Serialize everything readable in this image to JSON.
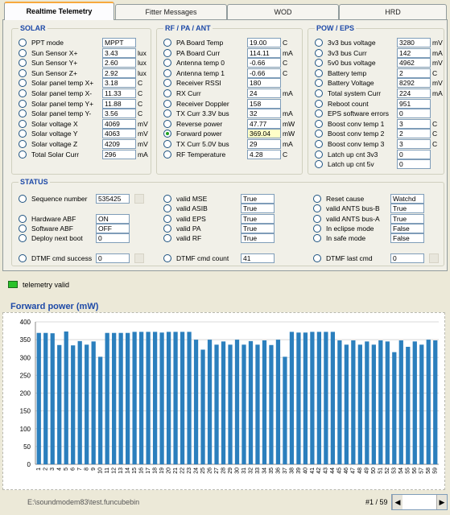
{
  "tabs": [
    "Realtime Telemetry",
    "Fitter Messages",
    "WOD",
    "HRD"
  ],
  "solar": {
    "title": "SOLAR",
    "rows": [
      {
        "label": "PPT mode",
        "value": "MPPT",
        "unit": ""
      },
      {
        "label": "Sun Sensor X+",
        "value": "3.43",
        "unit": "lux"
      },
      {
        "label": "Sun Sensor Y+",
        "value": "2.60",
        "unit": "lux"
      },
      {
        "label": "Sun Sensor Z+",
        "value": "2.92",
        "unit": "lux"
      },
      {
        "label": "Solar panel temp X+",
        "value": "3.18",
        "unit": "C"
      },
      {
        "label": "Solar panel temp X-",
        "value": "11.33",
        "unit": "C"
      },
      {
        "label": "Solar panel temp Y+",
        "value": "11.88",
        "unit": "C"
      },
      {
        "label": "Solar panel temp Y-",
        "value": "3.56",
        "unit": "C"
      },
      {
        "label": "Solar voltage X",
        "value": "4069",
        "unit": "mV"
      },
      {
        "label": "Solar voltage Y",
        "value": "4063",
        "unit": "mV"
      },
      {
        "label": "Solar voltage Z",
        "value": "4209",
        "unit": "mV"
      },
      {
        "label": "Total Solar Curr",
        "value": "296",
        "unit": "mA"
      }
    ]
  },
  "rfpa": {
    "title": "RF / PA / ANT",
    "rows": [
      {
        "label": "PA Board Temp",
        "value": "19.00",
        "unit": "C"
      },
      {
        "label": "PA Board Curr",
        "value": "114.11",
        "unit": "mA"
      },
      {
        "label": "Antenna temp 0",
        "value": "-0.66",
        "unit": "C"
      },
      {
        "label": "Antenna temp 1",
        "value": "-0.66",
        "unit": "C"
      },
      {
        "label": "Receiver RSSI",
        "value": "180",
        "unit": ""
      },
      {
        "label": "RX Curr",
        "value": "24",
        "unit": "mA"
      },
      {
        "label": "Receiver Doppler",
        "value": "158",
        "unit": ""
      },
      {
        "label": "TX Curr 3.3V bus",
        "value": "32",
        "unit": "mA"
      },
      {
        "label": "Reverse power",
        "value": "47.77",
        "unit": "mW"
      },
      {
        "label": "Forward power",
        "value": "369.04",
        "unit": "mW"
      },
      {
        "label": "TX Curr 5.0V bus",
        "value": "29",
        "unit": "mA"
      },
      {
        "label": "RF Temperature",
        "value": "4.28",
        "unit": "C"
      }
    ]
  },
  "poweps": {
    "title": "POW / EPS",
    "rows": [
      {
        "label": "3v3 bus voltage",
        "value": "3280",
        "unit": "mV"
      },
      {
        "label": "3v3 bus Curr",
        "value": "142",
        "unit": "mA"
      },
      {
        "label": "5v0 bus voltage",
        "value": "4962",
        "unit": "mV"
      },
      {
        "label": "Battery temp",
        "value": "2",
        "unit": "C"
      },
      {
        "label": "Battery Voltage",
        "value": "8292",
        "unit": "mV"
      },
      {
        "label": "Total system Curr",
        "value": "224",
        "unit": "mA"
      },
      {
        "label": "Reboot count",
        "value": "951",
        "unit": ""
      },
      {
        "label": "EPS software errors",
        "value": "0",
        "unit": ""
      },
      {
        "label": "Boost conv temp 1",
        "value": "3",
        "unit": "C"
      },
      {
        "label": "Boost conv temp 2",
        "value": "2",
        "unit": "C"
      },
      {
        "label": "Boost conv temp 3",
        "value": "3",
        "unit": "C"
      },
      {
        "label": "Latch up cnt 3v3",
        "value": "0",
        "unit": ""
      },
      {
        "label": "Latch up cnt 5v",
        "value": "0",
        "unit": ""
      }
    ]
  },
  "status": {
    "title": "STATUS",
    "sequence": {
      "label": "Sequence number",
      "value": "535425"
    },
    "hardware_abf": {
      "label": "Hardware ABF",
      "value": "ON"
    },
    "software_abf": {
      "label": "Software ABF",
      "value": "OFF"
    },
    "deploy_next_boot": {
      "label": "Deploy next boot",
      "value": "0"
    },
    "dtmf_success": {
      "label": "DTMF cmd success",
      "value": "0"
    },
    "valid_mse": {
      "label": "valid MSE",
      "value": "True"
    },
    "valid_asib": {
      "label": "valid ASIB",
      "value": "True"
    },
    "valid_eps": {
      "label": "valid EPS",
      "value": "True"
    },
    "valid_pa": {
      "label": "valid PA",
      "value": "True"
    },
    "valid_rf": {
      "label": "valid RF",
      "value": "True"
    },
    "dtmf_count": {
      "label": "DTMF cmd count",
      "value": "41"
    },
    "reset_cause": {
      "label": "Reset cause",
      "value": "Watchd"
    },
    "valid_ants_b": {
      "label": "valid ANTS bus-B",
      "value": "True"
    },
    "valid_ants_a": {
      "label": "valid ANTS bus-A",
      "value": "True"
    },
    "eclipse": {
      "label": "In eclipse mode",
      "value": "False"
    },
    "safe_mode": {
      "label": "In safe mode",
      "value": "False"
    },
    "dtmf_last": {
      "label": "DTMF last cmd",
      "value": "0"
    }
  },
  "telemetry_valid": "telemetry valid",
  "telemetry_led_color": "#2ac22a",
  "chart_title": "Forward power (mW)",
  "chart_data": {
    "type": "bar",
    "title": "Forward power (mW)",
    "xlabel": "",
    "ylabel": "",
    "ylim": [
      0,
      400
    ],
    "yticks": [
      0,
      50,
      100,
      150,
      200,
      250,
      300,
      350,
      400
    ],
    "grid": true,
    "bar_color": "#2b7fbd",
    "categories": [
      "1",
      "2",
      "3",
      "4",
      "5",
      "6",
      "7",
      "8",
      "9",
      "10",
      "11",
      "12",
      "13",
      "14",
      "15",
      "16",
      "17",
      "18",
      "19",
      "20",
      "21",
      "22",
      "23",
      "24",
      "25",
      "26",
      "27",
      "28",
      "29",
      "30",
      "31",
      "32",
      "33",
      "34",
      "35",
      "36",
      "37",
      "38",
      "39",
      "40",
      "41",
      "42",
      "43",
      "44",
      "45",
      "46",
      "47",
      "48",
      "49",
      "50",
      "51",
      "52",
      "53",
      "54",
      "55",
      "56",
      "57",
      "58",
      "59"
    ],
    "values": [
      369,
      369,
      368,
      335,
      373,
      334,
      346,
      336,
      345,
      302,
      369,
      369,
      369,
      369,
      372,
      372,
      372,
      372,
      370,
      372,
      372,
      372,
      372,
      350,
      322,
      350,
      336,
      345,
      336,
      350,
      336,
      346,
      336,
      348,
      335,
      350,
      302,
      372,
      370,
      370,
      372,
      372,
      372,
      372,
      348,
      336,
      348,
      336,
      345,
      336,
      348,
      345,
      315,
      348,
      330,
      345,
      336,
      350,
      348
    ]
  },
  "status_path": "E:\\soundmodem83\\test.funcubebin",
  "pager": "#1 / 59"
}
